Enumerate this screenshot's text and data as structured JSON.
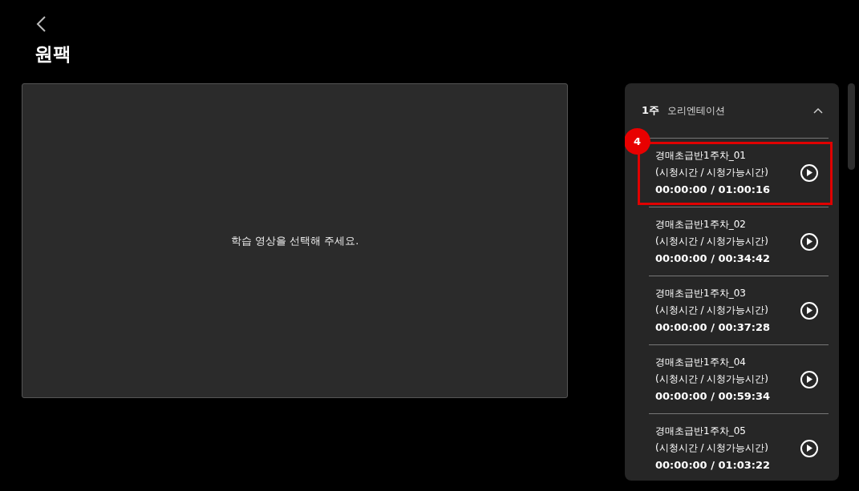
{
  "page": {
    "title": "원팩"
  },
  "player": {
    "message": "학습 영상을 선택해 주세요."
  },
  "playlist": {
    "week": "1주",
    "section_title": "오리엔테이션",
    "expanded": true,
    "items": [
      {
        "title": "경매초급반1주차_01",
        "caption": "(시청시간 / 시청가능시간)",
        "time": "00:00:00 / 01:00:16",
        "highlighted": true,
        "badge": "4"
      },
      {
        "title": "경매초급반1주차_02",
        "caption": "(시청시간 / 시청가능시간)",
        "time": "00:00:00 / 00:34:42",
        "highlighted": false
      },
      {
        "title": "경매초급반1주차_03",
        "caption": "(시청시간 / 시청가능시간)",
        "time": "00:00:00 / 00:37:28",
        "highlighted": false
      },
      {
        "title": "경매초급반1주차_04",
        "caption": "(시청시간 / 시청가능시간)",
        "time": "00:00:00 / 00:59:34",
        "highlighted": false
      },
      {
        "title": "경매초급반1주차_05",
        "caption": "(시청시간 / 시청가능시간)",
        "time": "00:00:00 / 01:03:22",
        "highlighted": false
      }
    ]
  }
}
